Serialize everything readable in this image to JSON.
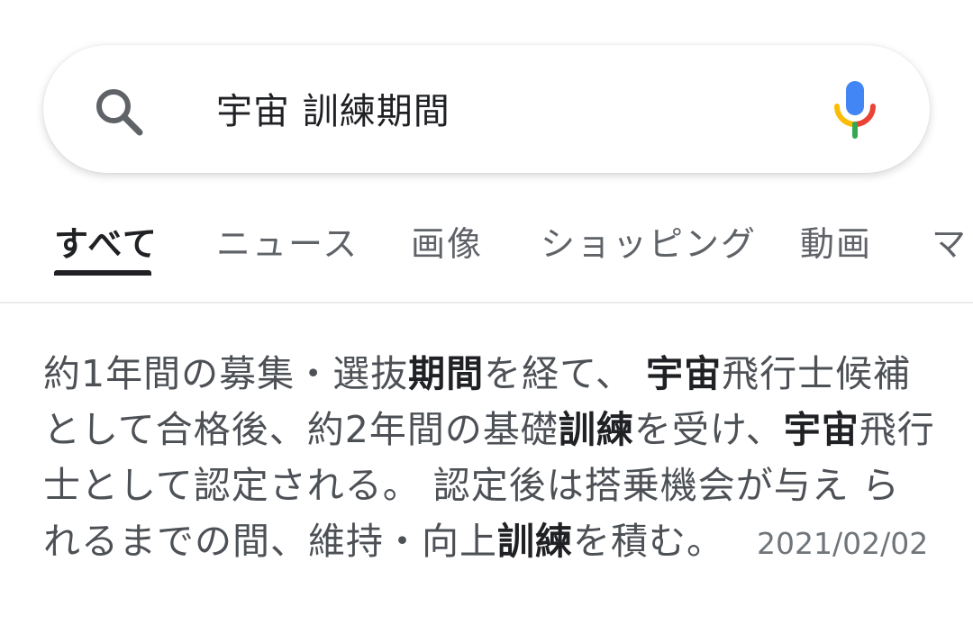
{
  "search": {
    "query": "宇宙 訓練期間"
  },
  "tabs": [
    {
      "label": "すべて",
      "active": true
    },
    {
      "label": "ニュース"
    },
    {
      "label": "画像"
    },
    {
      "label": "ショッピング"
    },
    {
      "label": "動画"
    },
    {
      "label": "マ"
    }
  ],
  "snippet": {
    "parts": [
      "約1年間の募集・選抜",
      "期間",
      "を経て、 ",
      "宇宙",
      "飛行士候補として合格後、約2年間の基礎",
      "訓練",
      "を受け、",
      "宇宙",
      "飛行士として認定される。 認定後は搭乗機会が与え られるまでの間、維持・向上",
      "訓練",
      "を積む。"
    ],
    "date": "2021/02/02"
  },
  "icons": {
    "search": "search-icon",
    "mic": "microphone-icon"
  },
  "colors": {
    "mic_blue": "#4285F4",
    "mic_red": "#EA4335",
    "mic_yellow": "#FBBC05",
    "mic_green": "#34A853"
  }
}
